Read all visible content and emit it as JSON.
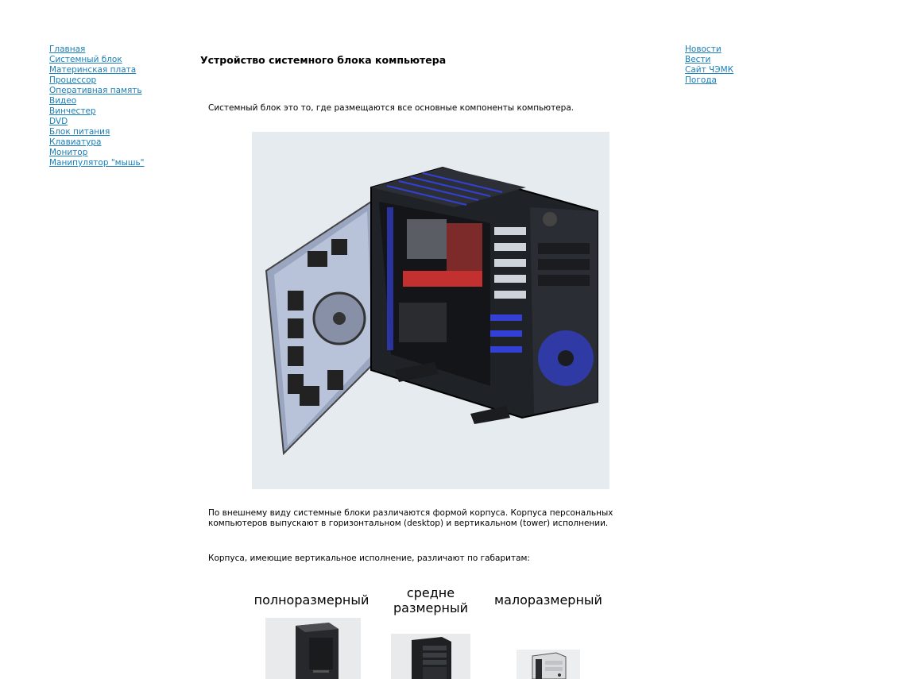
{
  "left_nav": [
    "Главная",
    "Системный блок",
    "Материнская плата",
    "Процессор",
    "Оперативная память",
    "Видео",
    "Винчестер",
    "DVD",
    "Блок питания",
    "Клавиатура",
    "Монитор",
    "Манипулятор \"мышь\""
  ],
  "right_nav": [
    "Новости",
    "Вести",
    "Сайт ЧЭМК",
    "Погода"
  ],
  "main": {
    "title": "Устройство системного блока компьютера",
    "intro": "Системный блок это то, где размещаются все основные компоненты компьютера.",
    "para1_line1": "По внешнему виду системные блоки различаются формой корпуса. Корпуса персональных",
    "para1_line2": "компьютеров выпускают в горизонтальном (desktop) и вертикальном (tower) исполнении.",
    "para2": "Корпуса, имеющие вертикальное исполнение, различают по габаритам:",
    "sizes": {
      "full_label": "полноразмерный",
      "mid_label_line1": "средне",
      "mid_label_line2": "размерный",
      "small_label": "малоразмерный"
    }
  },
  "colors": {
    "link": "#1a7fb8",
    "hero_bg": "#e6ebf0",
    "case_glow": "#3340d6"
  }
}
